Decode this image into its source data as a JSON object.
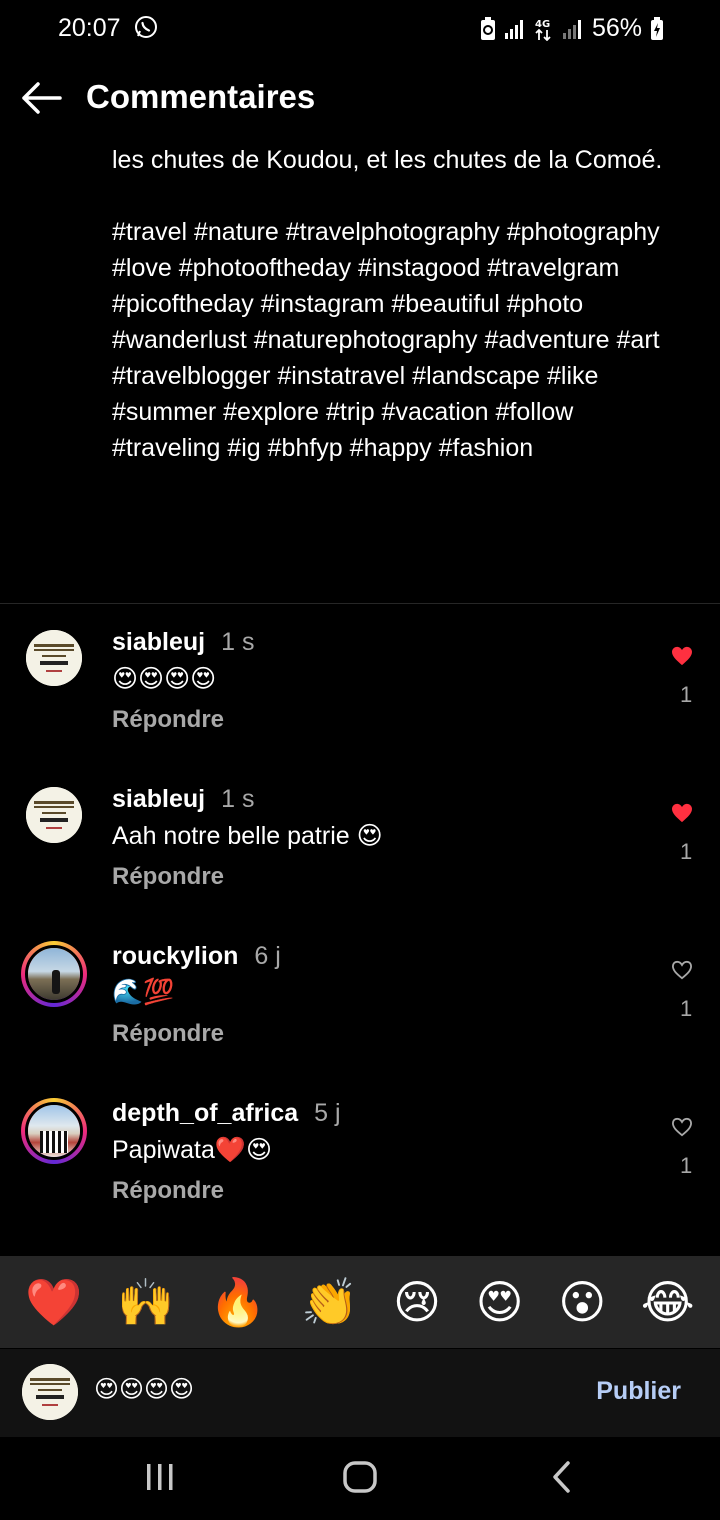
{
  "status_bar": {
    "time": "20:07",
    "network": "4G",
    "battery": "56%",
    "icons": [
      "whatsapp-icon",
      "battery-saver-icon",
      "signal-icon",
      "data-4g-icon",
      "signal-icon",
      "battery-icon"
    ]
  },
  "header": {
    "title": "Commentaires",
    "back_icon": "arrow-left-icon"
  },
  "caption": {
    "text": "les chutes de Koudou, et les chutes de la Comoé.",
    "hashtags": "#travel #nature #travelphotography #photography #love #photooftheday #instagood #travelgram #picoftheday #instagram #beautiful #photo #wanderlust #naturephotography #adventure #art #travelblogger #instatravel #landscape #like #summer #explore #trip #vacation #follow #traveling #ig #bhfyp #happy #fashion"
  },
  "comments": [
    {
      "username": "siableuj",
      "time": "1 s",
      "text": "😍😍😍😍",
      "reply_label": "Répondre",
      "likes": "1",
      "liked": true
    },
    {
      "username": "siableuj",
      "time": "1 s",
      "text": "Aah notre belle patrie 😍",
      "reply_label": "Répondre",
      "likes": "1",
      "liked": true
    },
    {
      "username": "rouckylion",
      "time": "6 j",
      "text": "🌊💯",
      "reply_label": "Répondre",
      "likes": "1",
      "liked": false
    },
    {
      "username": "depth_of_africa",
      "time": "5 j",
      "text": "Papiwata❤️😍",
      "reply_label": "Répondre",
      "likes": "1",
      "liked": false
    }
  ],
  "emoji_bar": [
    "❤️",
    "🙌",
    "🔥",
    "👏",
    "😢",
    "😍",
    "😮",
    "😂"
  ],
  "compose": {
    "value": "😍😍😍😍",
    "publish_label": "Publier"
  },
  "colors": {
    "background": "#000000",
    "like_red": "#ff3040",
    "publish_blue": "#b6cdf6",
    "secondary_text": "#a8a8a8"
  }
}
